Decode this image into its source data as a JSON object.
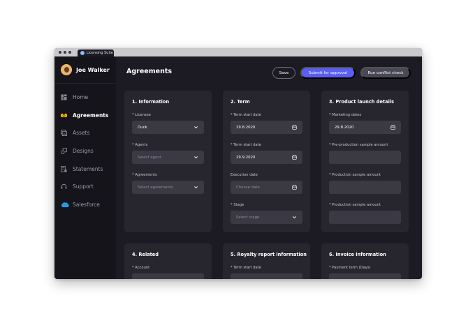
{
  "window": {
    "tab_title": "Licensing Suite"
  },
  "sidebar": {
    "user_name": "Joe Walker",
    "items": [
      {
        "label": "Home",
        "icon": "grid-icon",
        "active": false
      },
      {
        "label": "Agreements",
        "icon": "handshake-icon",
        "active": true
      },
      {
        "label": "Assets",
        "icon": "images-icon",
        "active": false
      },
      {
        "label": "Designs",
        "icon": "palette-icon",
        "active": false
      },
      {
        "label": "Statements",
        "icon": "document-icon",
        "active": false
      },
      {
        "label": "Support",
        "icon": "headset-icon",
        "active": false
      },
      {
        "label": "Salesforce",
        "icon": "salesforce-cloud-icon",
        "active": false
      }
    ]
  },
  "header": {
    "title": "Agreements",
    "save_label": "Save",
    "submit_label": "Submit for approval",
    "conflict_label": "Run conflict check"
  },
  "cards": {
    "information": {
      "title": "1. Information",
      "licensee_label": "* Licensee",
      "licensee_value": "Duck",
      "agents_label": "* Agents",
      "agents_placeholder": "Select agent",
      "agreements_label": "* Agreements",
      "agreements_placeholder": "Select agreements"
    },
    "term": {
      "title": "2. Term",
      "start_label": "* Term start date",
      "start_value": "29.8.2020",
      "end_label": "* Term start date",
      "end_value": "29.9.2020",
      "execution_label": "Execution date",
      "execution_placeholder": "Choose date",
      "stage_label": "* Stage",
      "stage_placeholder": "Select stage"
    },
    "launch": {
      "title": "3. Product launch details",
      "marketing_label": "* Marketing dates",
      "marketing_value": "29.8.2020",
      "preprod_label": "* Pre-production sample amount",
      "prod_label": "* Production sample amount",
      "prod2_label": "* Production sample amount"
    },
    "related": {
      "title": "4. Related",
      "account_label": "* Account"
    },
    "royalty": {
      "title": "5. Royalty report information",
      "start_label": "* Term start date"
    },
    "invoice": {
      "title": "6. Invoice information",
      "payment_label": "* Payment term (Days)"
    }
  },
  "colors": {
    "accent": "#5b5ef6",
    "background": "#1c1b24",
    "sidebar": "#15141b",
    "card": "#27262f",
    "input": "#3a3944",
    "active_icon": "#f5b700",
    "salesforce": "#1f9ee8"
  }
}
